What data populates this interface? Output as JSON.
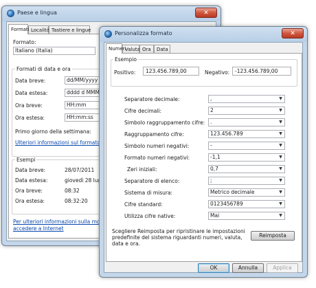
{
  "back_window": {
    "title": "Paese e lingua",
    "tabs": [
      "Formati",
      "Località",
      "Tastiere e lingue"
    ],
    "format_label": "Formato:",
    "format_value": "Italiano (Italia)",
    "datetime_group_title": "Formati di data e ora",
    "fields": [
      {
        "label": "Data breve:",
        "value": "dd/MM/yyyy"
      },
      {
        "label": "Data estesa:",
        "value": "dddd d MMMM yyyy"
      },
      {
        "label": "Ora breve:",
        "value": "HH:mm"
      },
      {
        "label": "Ora estesa:",
        "value": "HH:mm:ss"
      }
    ],
    "first_day_label": "Primo giorno della settimana:",
    "more_info_link": "Ulteriori informazioni sul formato",
    "examples_title": "Esempi",
    "examples": [
      {
        "label": "Data breve:",
        "value": "28/07/2011"
      },
      {
        "label": "Data estesa:",
        "value": "giovedì 28 luglio 2011"
      },
      {
        "label": "Ora breve:",
        "value": "08:32"
      },
      {
        "label": "Ora estesa:",
        "value": "08:32:20"
      }
    ],
    "bottom_link_line1": "Per ulteriori informazioni sulla modifica",
    "bottom_link_line2": "accedere a Internet"
  },
  "front_window": {
    "title": "Personalizza formato",
    "tabs": [
      "Numeri",
      "Valuta",
      "Ora",
      "Data"
    ],
    "example_title": "Esempio",
    "positive_label": "Positivo:",
    "positive_value": "123.456.789,00",
    "negative_label": "Negativo:",
    "negative_value": "-123.456.789,00",
    "settings": [
      {
        "label": "Separatore decimale:",
        "value": ","
      },
      {
        "label": "Cifre decimali:",
        "value": "2"
      },
      {
        "label": "Simbolo raggruppamento cifre:",
        "value": "."
      },
      {
        "label": "Raggruppamento cifre:",
        "value": "123.456.789"
      },
      {
        "label": "Simbolo numeri negativi:",
        "value": "-"
      },
      {
        "label": "Formato numeri negativi:",
        "value": "-1,1"
      },
      {
        "label": "Zeri iniziali:",
        "value": "0,7"
      },
      {
        "label": "Separatore di elenco:",
        "value": ";"
      },
      {
        "label": "Sistema di misura:",
        "value": "Metrico decimale"
      },
      {
        "label": "Cifre standard:",
        "value": "0123456789"
      },
      {
        "label": "Utilizza cifre native:",
        "value": "Mai"
      }
    ],
    "reset_note": "Scegliere Reimposta per ripristinare le impostazioni predefinite del sistema riguardanti numeri, valuta, data e ora.",
    "reset_button": "Reimposta",
    "ok_button": "OK",
    "cancel_button": "Annulla",
    "apply_button": "Applica"
  }
}
